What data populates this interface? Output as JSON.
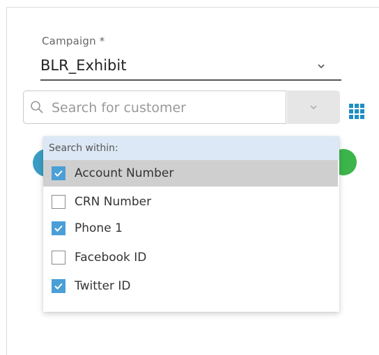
{
  "campaign": {
    "label": "Campaign *",
    "value": "BLR_Exhibit"
  },
  "search": {
    "placeholder": "Search for customer"
  },
  "dropdown": {
    "header": "Search within:",
    "options": [
      {
        "label": "Account Number",
        "checked": true,
        "highlighted": true
      },
      {
        "label": "CRN Number",
        "checked": false,
        "highlighted": false
      },
      {
        "label": "Phone 1",
        "checked": true,
        "highlighted": false
      },
      {
        "label": "Facebook ID",
        "checked": false,
        "highlighted": false
      },
      {
        "label": "Twitter ID",
        "checked": true,
        "highlighted": false
      }
    ]
  },
  "colors": {
    "checkbox_checked": "#4a9fd6",
    "header_bg": "#dce8f5",
    "highlight_bg": "#cfcfcf",
    "grid_icon": "#1e8fc4"
  },
  "icons": {
    "search": "search-icon",
    "campaign_dropdown": "chevron-down-icon",
    "search_dropdown": "chevron-down-icon",
    "grid": "grid-icon",
    "checkbox": "checkmark-icon"
  }
}
